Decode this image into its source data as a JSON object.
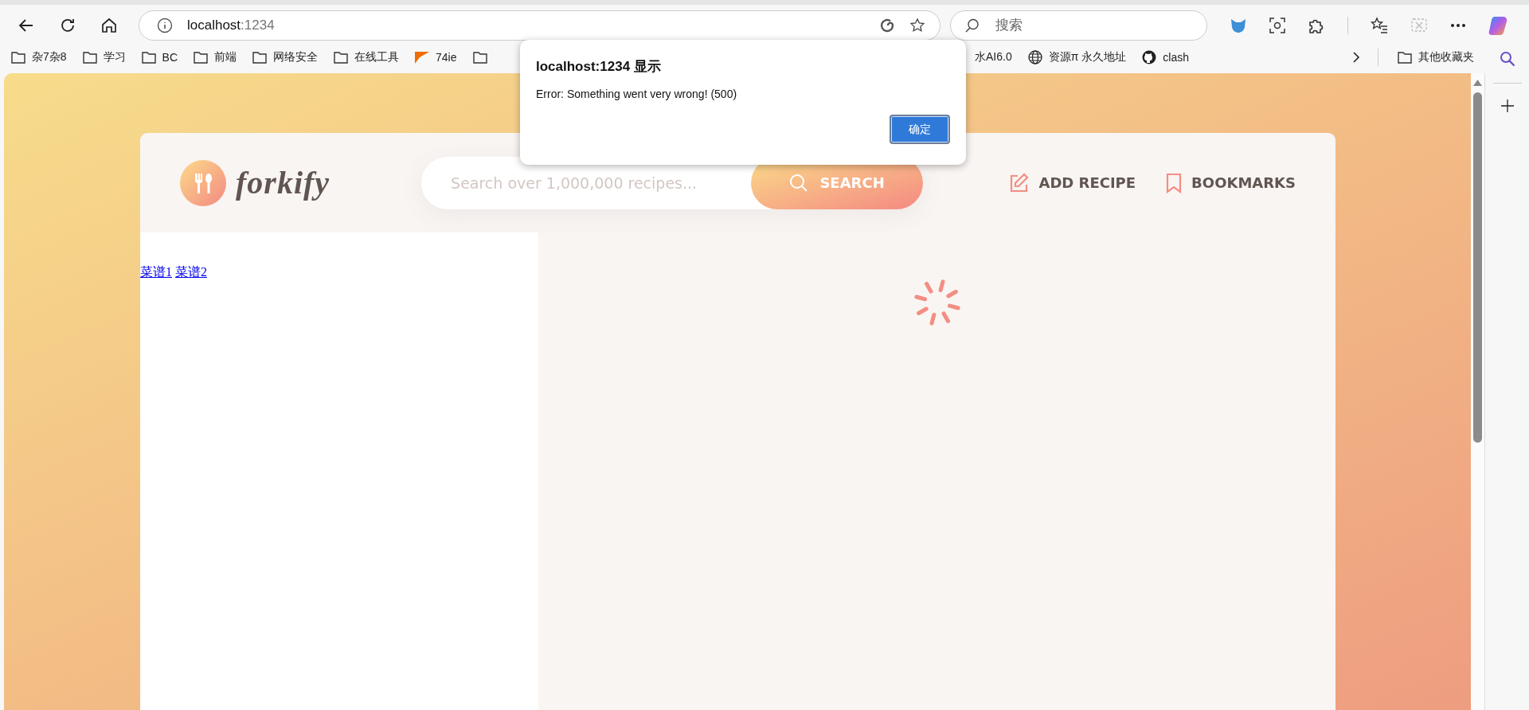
{
  "browser": {
    "address": {
      "host": "localhost",
      "port": ":1234"
    },
    "search_placeholder": "搜索"
  },
  "bookmarks": [
    {
      "kind": "folder",
      "label": "杂7杂8"
    },
    {
      "kind": "folder",
      "label": "学习"
    },
    {
      "kind": "folder",
      "label": "BC"
    },
    {
      "kind": "folder",
      "label": "前端"
    },
    {
      "kind": "folder",
      "label": "网络安全"
    },
    {
      "kind": "folder",
      "label": "在线工具"
    },
    {
      "kind": "site",
      "label": "74ie"
    },
    {
      "kind": "folder"
    }
  ],
  "bookmarks_right": [
    {
      "kind": "text",
      "label": "水AI6.0"
    },
    {
      "kind": "globe",
      "label": "资源π 永久地址"
    },
    {
      "kind": "github",
      "label": "clash"
    }
  ],
  "other_bookmarks": "其他收藏夹",
  "app": {
    "logo": "forkify",
    "search": {
      "placeholder": "Search over 1,000,000 recipes...",
      "button": "SEARCH"
    },
    "nav": [
      {
        "kind": "add",
        "label": "ADD RECIPE"
      },
      {
        "kind": "bookmark",
        "label": "BOOKMARKS"
      }
    ],
    "links": [
      "菜谱1",
      "菜谱2"
    ],
    "loading": true
  },
  "dialog": {
    "title": "localhost:1234 显示",
    "message": "Error: Something went very wrong! (500)",
    "button": "确定"
  }
}
